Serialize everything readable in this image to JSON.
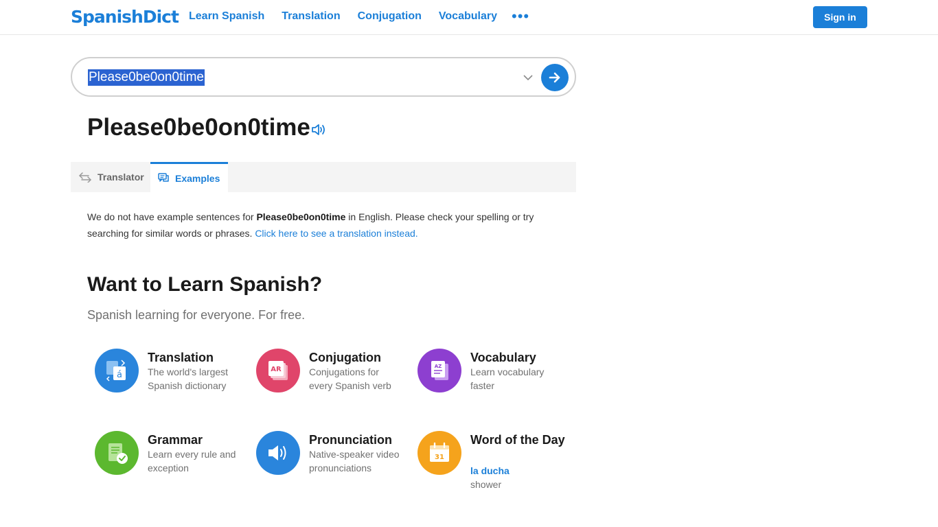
{
  "header": {
    "logo": "SpanishDict",
    "nav": [
      "Learn Spanish",
      "Translation",
      "Conjugation",
      "Vocabulary"
    ],
    "more": "•••",
    "signin": "Sign in"
  },
  "search": {
    "value": "Please0be0on0time"
  },
  "title": "Please0be0on0time",
  "tabs": {
    "translator": "Translator",
    "examples": "Examples"
  },
  "message": {
    "before": "We do not have example sentences for ",
    "term": "Please0be0on0time",
    "after": " in English. Please check your spelling or try searching for similar words or phrases. ",
    "link": "Click here to see a translation instead."
  },
  "learn": {
    "heading": "Want to Learn Spanish?",
    "sub": "Spanish learning for everyone. For free.",
    "features": [
      {
        "title": "Translation",
        "desc": "The world's largest Spanish dictionary"
      },
      {
        "title": "Conjugation",
        "desc": "Conjugations for every Spanish verb"
      },
      {
        "title": "Vocabulary",
        "desc": "Learn vocabulary faster"
      },
      {
        "title": "Grammar",
        "desc": "Learn every rule and exception"
      },
      {
        "title": "Pronunciation",
        "desc": "Native-speaker video pronunciations"
      },
      {
        "title": "Word of the Day",
        "word": "la ducha",
        "meaning": "shower"
      }
    ]
  },
  "colors": {
    "brand": "#1b7fd8",
    "translation": "#2a85dc",
    "conjugation": "#e0456a",
    "vocabulary": "#8d3fd0",
    "grammar": "#5cb82f",
    "pronunciation": "#2a85dc",
    "word_of_day": "#f5a31c"
  },
  "icons": {
    "more": "ellipsis-icon",
    "dropdown": "chevron-down-icon",
    "submit": "arrow-right-icon",
    "audio": "speaker-icon",
    "translator_tab": "swap-arrows-icon",
    "examples_tab": "chat-bubbles-icon",
    "features": [
      "translation-icon",
      "conjugation-icon",
      "vocabulary-icon",
      "grammar-icon",
      "pronunciation-icon",
      "calendar-icon"
    ]
  },
  "calendar_day": "31"
}
